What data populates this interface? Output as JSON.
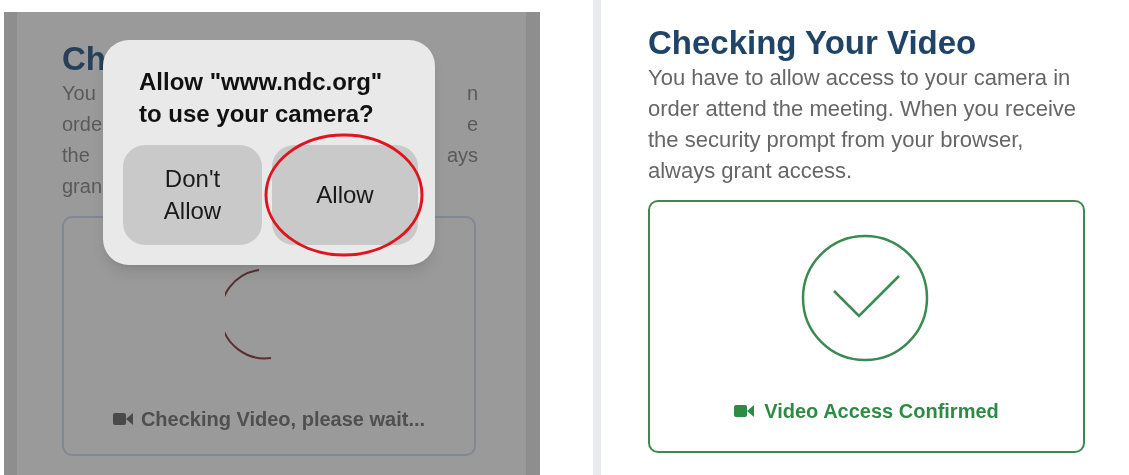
{
  "before": {
    "title_fragment": "Ch",
    "text_fragments": [
      {
        "left": "You",
        "right": "n"
      },
      {
        "left": "orde",
        "right": "e"
      },
      {
        "left": "the",
        "right": "ays"
      },
      {
        "left": "gran"
      }
    ],
    "status": {
      "kind": "checking",
      "text": "Checking Video, please wait..."
    },
    "dialog": {
      "title_lines": [
        "Allow \"www.ndc.org\"",
        "to use your camera?"
      ],
      "buttons": [
        {
          "label": "Don't Allow",
          "highlighted": false
        },
        {
          "label": "Allow",
          "highlighted": true
        }
      ]
    }
  },
  "after": {
    "title": "Checking Your Video",
    "description": "You have to allow access to your camera in order attend the meeting. When you receive the security prompt from your browser, always grant access.",
    "status": {
      "kind": "confirmed",
      "text": "Video Access Confirmed"
    }
  }
}
